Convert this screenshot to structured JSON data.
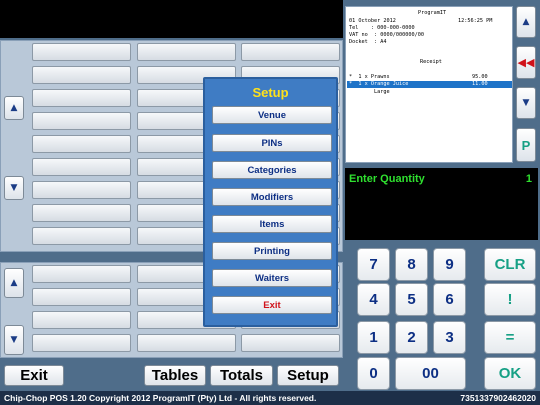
{
  "left_panel": {
    "scroll_up_icon": "up-triangle",
    "scroll_down_icon": "down-triangle"
  },
  "bottom_buttons": {
    "exit": "Exit",
    "tables": "Tables",
    "totals": "Totals",
    "setup": "Setup"
  },
  "receipt": {
    "company": "ProgramIT",
    "date": "01 October 2012",
    "time": "12:56:25 PM",
    "tel": "Tel    : 000-000-0000",
    "vat": "VAT no  : 0000/000000/00",
    "docket": "Docket  : A4",
    "heading": "Receipt",
    "items": [
      {
        "text": "*  1 x Prawns",
        "price": "95.00",
        "selected": false
      },
      {
        "text": "*  1 x Orange Juice",
        "price": "11.00",
        "selected": true
      }
    ],
    "modifier": "Large"
  },
  "side_buttons": {
    "up_icon": "up-triangle",
    "rewind_icon": "double-left-arrow",
    "down_icon": "down-triangle",
    "p_label": "P"
  },
  "display": {
    "prompt": "Enter Quantity",
    "value": "1"
  },
  "keypad": {
    "keys": [
      "7",
      "8",
      "9",
      "4",
      "5",
      "6",
      "1",
      "2",
      "3",
      "0",
      "00"
    ],
    "clr": "CLR",
    "bang": "!",
    "equals": "=",
    "ok": "OK"
  },
  "setup_menu": {
    "title": "Setup",
    "items": [
      "Venue",
      "PINs",
      "Categories",
      "Modifiers",
      "Items",
      "Printing",
      "Waiters",
      "Exit"
    ]
  },
  "status": {
    "copyright": "Chip-Chop POS 1.20 Copyright 2012 ProgramIT (Pty) Ltd - All rights reserved.",
    "code": "7351337902462020"
  },
  "colors": {
    "background": "#4f6d8a",
    "menu": "#3f7cc4",
    "menu_title": "#ffe21a",
    "display_text": "#2fe02f",
    "highlight": "#1e73c8",
    "exit_red": "#d0121a"
  }
}
